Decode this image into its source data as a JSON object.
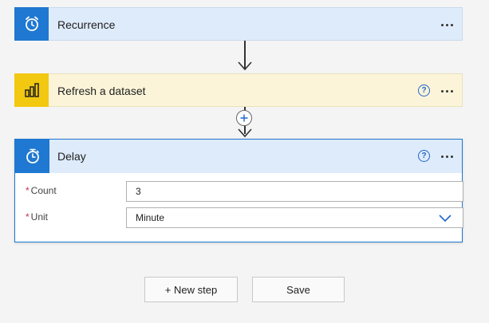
{
  "steps": {
    "recurrence": {
      "title": "Recurrence"
    },
    "refresh": {
      "title": "Refresh a dataset"
    },
    "delay": {
      "title": "Delay",
      "fields": [
        {
          "label": "Count",
          "required_mark": "*",
          "value": "3"
        },
        {
          "label": "Unit",
          "required_mark": "*",
          "value": "Minute"
        }
      ]
    }
  },
  "help_glyph": "?",
  "buttons": {
    "new_step": "+ New step",
    "save": "Save"
  },
  "colors": {
    "accent_blue": "#1f78d1",
    "powerbi_yellow": "#f2c811",
    "required_red": "#c4314b"
  },
  "icons": {
    "recurrence": "alarm-clock-icon",
    "refresh": "power-bi-icon",
    "delay": "timer-icon"
  }
}
